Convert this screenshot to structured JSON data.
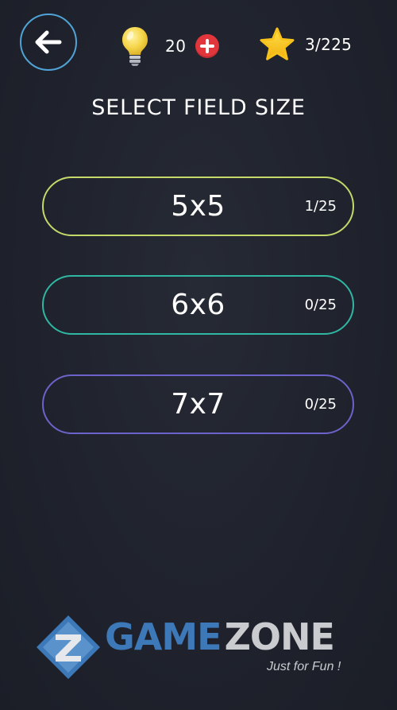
{
  "header": {
    "back_icon": "arrow-left-icon",
    "hints": {
      "icon": "lightbulb-icon",
      "count": "20",
      "add_icon": "plus-icon"
    },
    "stars": {
      "icon": "star-icon",
      "progress": "3/225",
      "earned": 3,
      "total": 225
    }
  },
  "title": "SELECT FIELD SIZE",
  "field_sizes": [
    {
      "label": "5x5",
      "progress": "1/25",
      "border_color": "#c4d96a"
    },
    {
      "label": "6x6",
      "progress": "0/25",
      "border_color": "#2fb7a3"
    },
    {
      "label": "7x7",
      "progress": "0/25",
      "border_color": "#6b63c9"
    }
  ],
  "watermark": {
    "brand": "GAME",
    "brand_suffix": "ZONE",
    "tagline": "Just for Fun !"
  },
  "colors": {
    "background": "#1f222c",
    "back_ring": "#4fa3d6",
    "add_button": "#e1363b",
    "bulb": "#f5d54a",
    "star": "#f6c21b"
  }
}
